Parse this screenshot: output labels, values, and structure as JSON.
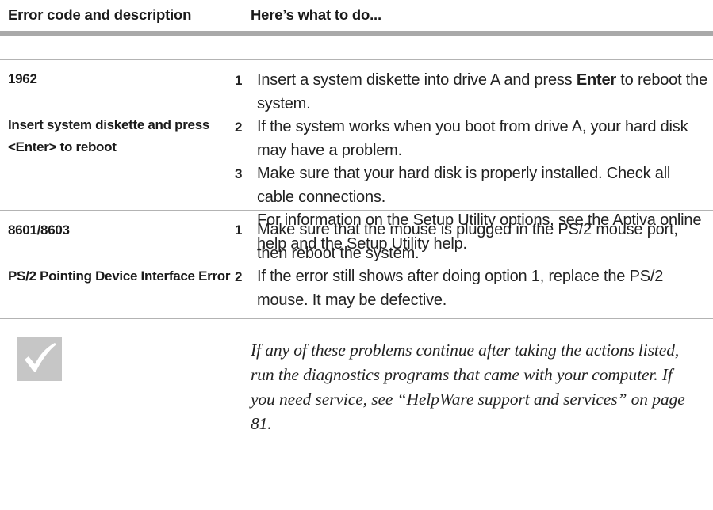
{
  "header": {
    "col_code": "Error code and description",
    "col_todo": "Here’s what to do..."
  },
  "errors": [
    {
      "code": "1962",
      "description": "Insert system diskette and press <Enter> to reboot",
      "steps": [
        {
          "num": "1",
          "pre": "Insert a system diskette into drive A and press ",
          "bold": "Enter",
          "post": " to reboot the system."
        },
        {
          "num": "2",
          "text": "If the system works when you boot from drive A, your hard disk may have a problem."
        },
        {
          "num": "3",
          "text": "Make sure that your hard disk is properly installed. Check all cable connections."
        }
      ],
      "extra": "For information on the Setup Utility options, see the Aptiva online help and the Setup Utility help."
    },
    {
      "code": "8601/8603",
      "description": "PS/2 Pointing Device Interface Error",
      "steps": [
        {
          "num": "1",
          "text": "Make sure that the mouse is plugged in the PS/2 mouse port, then reboot the system."
        },
        {
          "num": "2",
          "text": "If the error still shows after doing option 1, replace the PS/2 mouse. It may be defective."
        }
      ]
    }
  ],
  "note": {
    "icon": "checkmark-icon",
    "text": "If any of these problems continue after taking the actions listed, run the diagnostics programs that came with your computer. If you need service, see “HelpWare support and services” on page 81."
  },
  "colors": {
    "rule_thick": "#a9a9a9",
    "rule_thin": "#b3b3b3",
    "check_bg": "#c6c6c6"
  }
}
